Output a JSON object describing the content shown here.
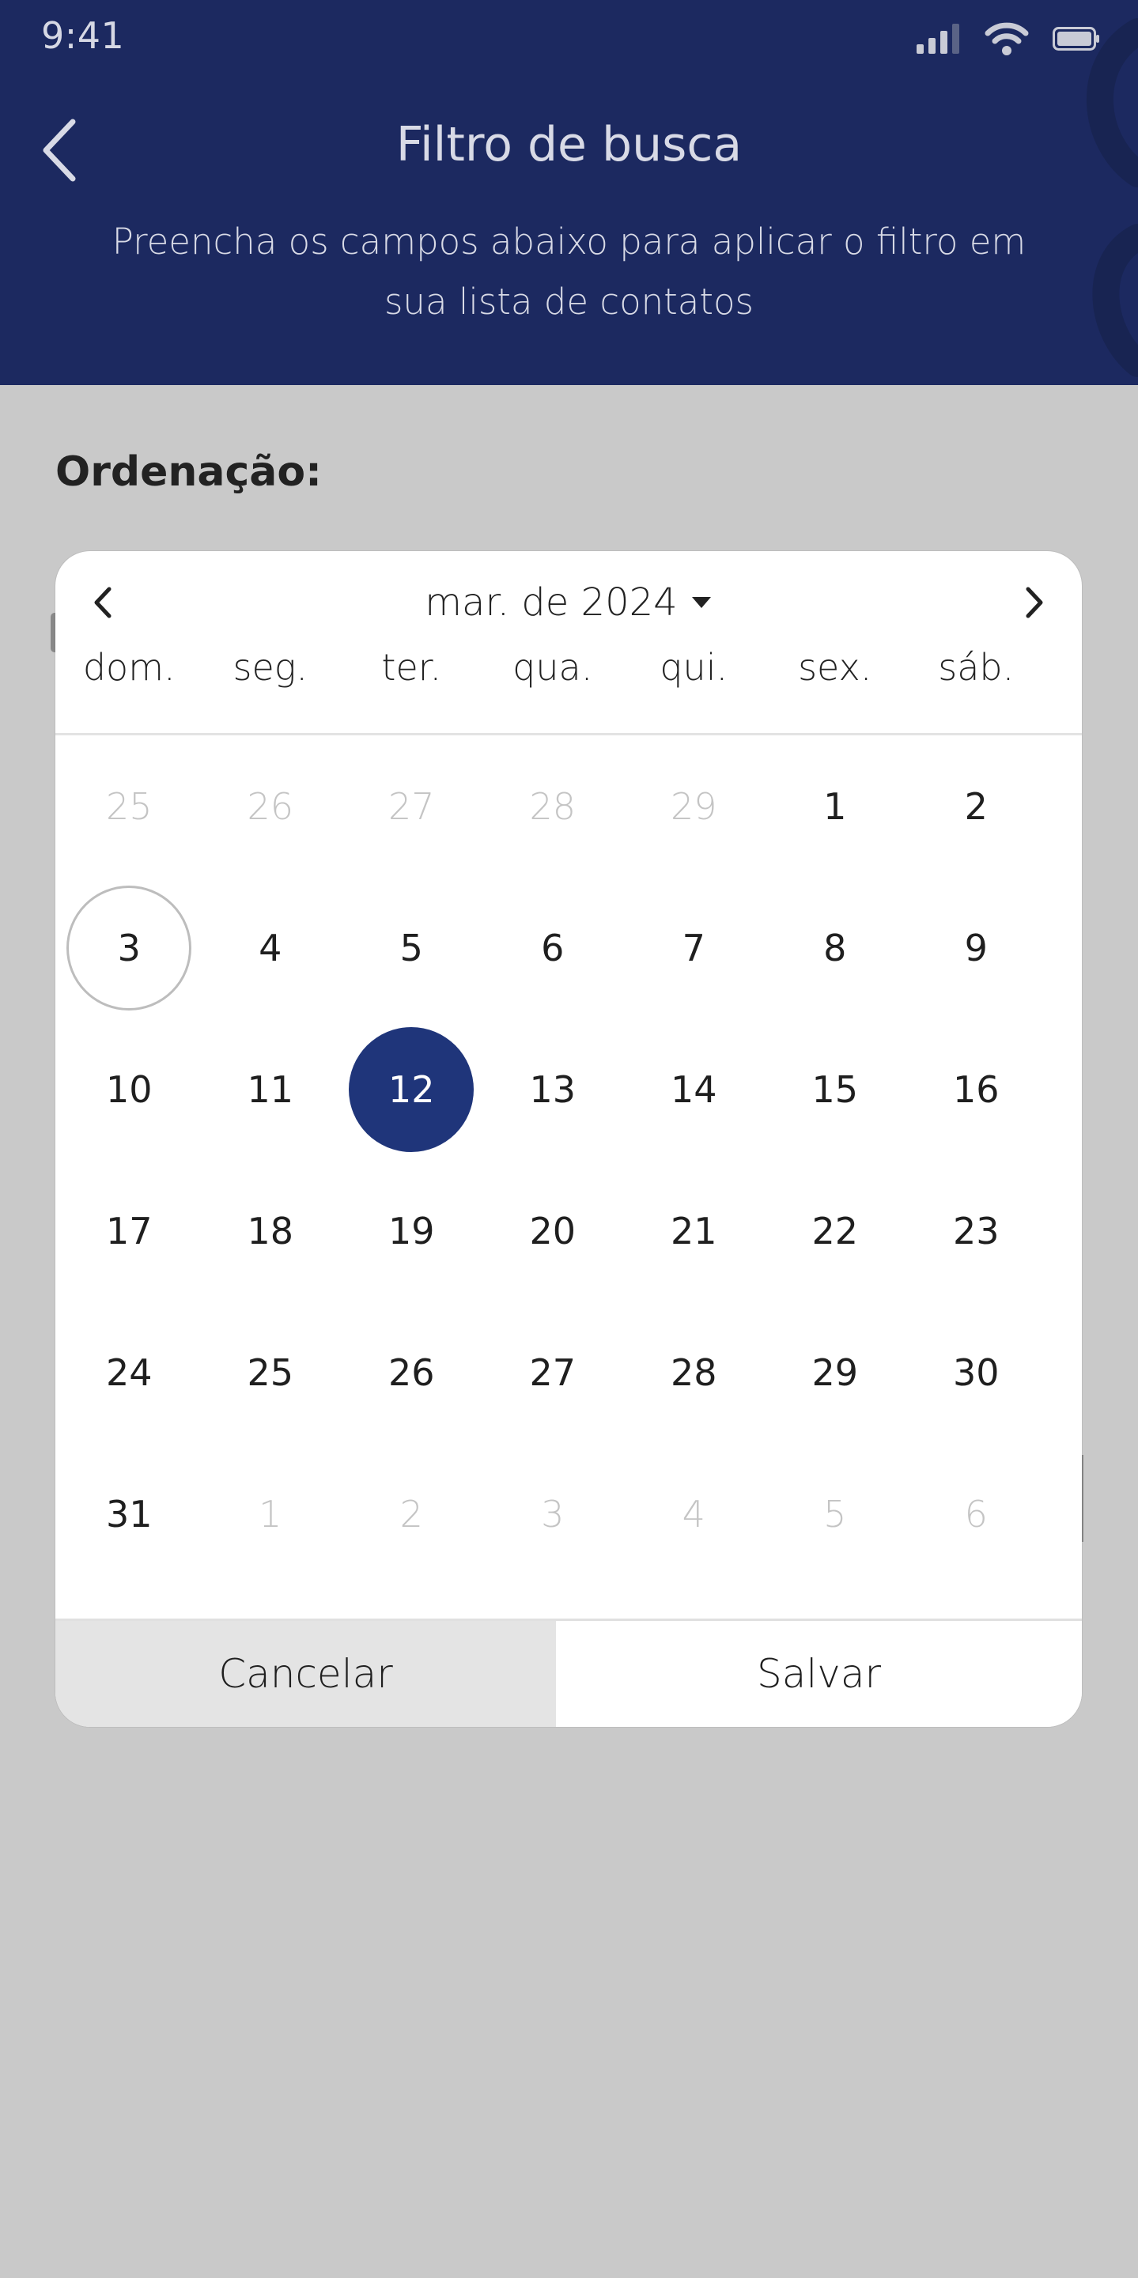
{
  "status_bar": {
    "time": "9:41",
    "icons": [
      "signal-icon",
      "wifi-icon",
      "battery-icon"
    ]
  },
  "header": {
    "title": "Filtro de busca",
    "subtitle": "Preencha os campos abaixo para aplicar o filtro em sua lista de contatos",
    "back_icon": "chevron-left-icon",
    "background_color": "#1c2960"
  },
  "section": {
    "label": "Ordenação:"
  },
  "date_picker": {
    "month_label": "mar. de 2024",
    "prev_icon": "chevron-left-icon",
    "next_icon": "chevron-right-icon",
    "dropdown_icon": "caret-down-icon",
    "weekdays": [
      "dom.",
      "seg.",
      "ter.",
      "qua.",
      "qui.",
      "sex.",
      "sáb."
    ],
    "days": [
      {
        "label": "25",
        "muted": true
      },
      {
        "label": "26",
        "muted": true
      },
      {
        "label": "27",
        "muted": true
      },
      {
        "label": "28",
        "muted": true
      },
      {
        "label": "29",
        "muted": true
      },
      {
        "label": "1"
      },
      {
        "label": "2"
      },
      {
        "label": "3",
        "today": true
      },
      {
        "label": "4"
      },
      {
        "label": "5"
      },
      {
        "label": "6"
      },
      {
        "label": "7"
      },
      {
        "label": "8"
      },
      {
        "label": "9"
      },
      {
        "label": "10"
      },
      {
        "label": "11"
      },
      {
        "label": "12",
        "selected": true
      },
      {
        "label": "13"
      },
      {
        "label": "14"
      },
      {
        "label": "15"
      },
      {
        "label": "16"
      },
      {
        "label": "17"
      },
      {
        "label": "18"
      },
      {
        "label": "19"
      },
      {
        "label": "20"
      },
      {
        "label": "21"
      },
      {
        "label": "22"
      },
      {
        "label": "23"
      },
      {
        "label": "24"
      },
      {
        "label": "25"
      },
      {
        "label": "26"
      },
      {
        "label": "27"
      },
      {
        "label": "28"
      },
      {
        "label": "29"
      },
      {
        "label": "30"
      },
      {
        "label": "31"
      },
      {
        "label": "1",
        "muted": true
      },
      {
        "label": "2",
        "muted": true
      },
      {
        "label": "3",
        "muted": true
      },
      {
        "label": "4",
        "muted": true
      },
      {
        "label": "5",
        "muted": true
      },
      {
        "label": "6",
        "muted": true
      }
    ],
    "selected_color": "#1f357a",
    "cancel_label": "Cancelar",
    "save_label": "Salvar"
  }
}
